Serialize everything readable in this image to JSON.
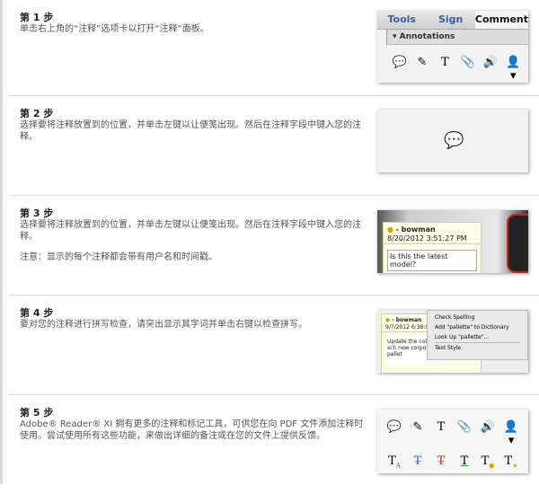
{
  "steps": [
    {
      "title": "第 1 步",
      "text": "单击右上角的“注释”选项卡以打开“注释”面板。"
    },
    {
      "title": "第 2 步",
      "text": "选择要将注释放置到的位置，并单击左键以让便笺出现。然后在注释字段中键入您的注释。"
    },
    {
      "title": "第 3 步",
      "text": "选择要将注释放置到的位置，并单击左键以让便笺出现。然后在注释字段中键入您的注释。",
      "note": "注意：显示的每个注释都会带有用户名和时间戳。"
    },
    {
      "title": "第 4 步",
      "text": "要对您的注释进行拼写检查，请突出显示其字词并单击右键以检查拼写。"
    },
    {
      "title": "第 5 步",
      "text": "Adobe® Reader® XI 拥有更多的注释和标记工具，可供您在向 PDF 文件添加注释时使用。尝试使用所有这些功能，来做出详细的备注或在您的文件上提供反馈。"
    }
  ],
  "shot1": {
    "tabs": [
      "Tools",
      "Sign",
      "Comment"
    ],
    "panel": "Annotations"
  },
  "shot3": {
    "user": "- bowman",
    "date": "8/20/2012 3:51:27 PM",
    "comment": "Is this the latest model?"
  },
  "shot4": {
    "user": "- bowman",
    "date": "9/7/2012 6:38:07 AM",
    "comment": "Update the color sch new corporate pallet",
    "menu": [
      "Check Spelling",
      "Add \"pallette\" to Dictionary",
      "Look Up \"pallette\"...",
      "Text Style"
    ]
  },
  "icons_row1": [
    "sticky-note-icon",
    "highlight-note-icon",
    "text-icon",
    "attach-icon",
    "audio-icon",
    "stamp-icon"
  ],
  "icons_row2": [
    "insert-text-icon",
    "replace-text-icon",
    "strikethrough-icon",
    "underline-icon",
    "text-comment-icon",
    "text-callout-icon"
  ]
}
